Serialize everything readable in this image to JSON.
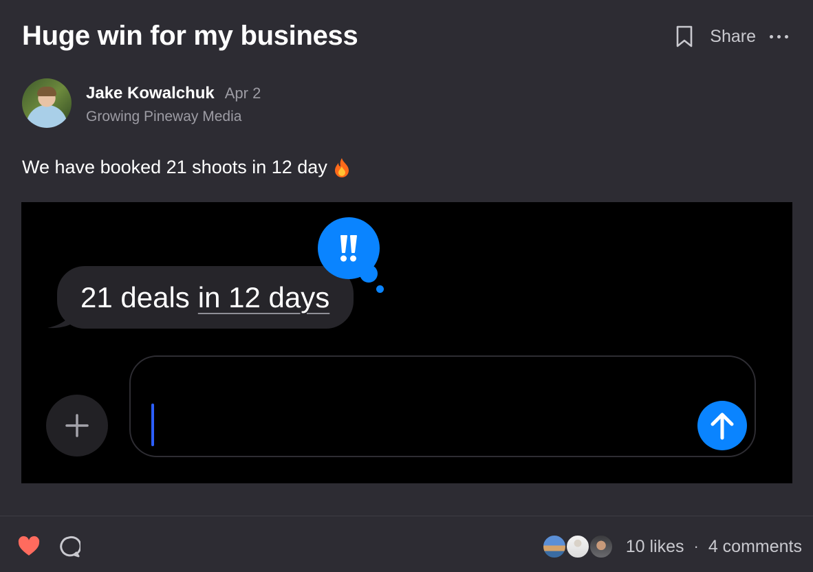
{
  "post": {
    "title": "Huge win for my business",
    "share_label": "Share",
    "body_text": "We have booked 21 shoots in 12 day"
  },
  "author": {
    "name": "Jake Kowalchuk",
    "date": "Apr 2",
    "subtitle": "Growing Pineway Media"
  },
  "media": {
    "message_text": "21 deals",
    "message_link_text": "in 12 days",
    "tapback_symbol": "!!"
  },
  "footer": {
    "likes_label": "10 likes",
    "comments_label": "4 comments",
    "separator": "·"
  },
  "colors": {
    "background": "#2d2c33",
    "accent_blue": "#0a84ff",
    "heart": "#ff6b5e",
    "muted_text": "#9d9ca4"
  },
  "icons": [
    "bookmark-icon",
    "more-icon",
    "fire-icon",
    "exclamation-icon",
    "plus-icon",
    "arrow-up-icon",
    "heart-icon",
    "comment-icon"
  ]
}
